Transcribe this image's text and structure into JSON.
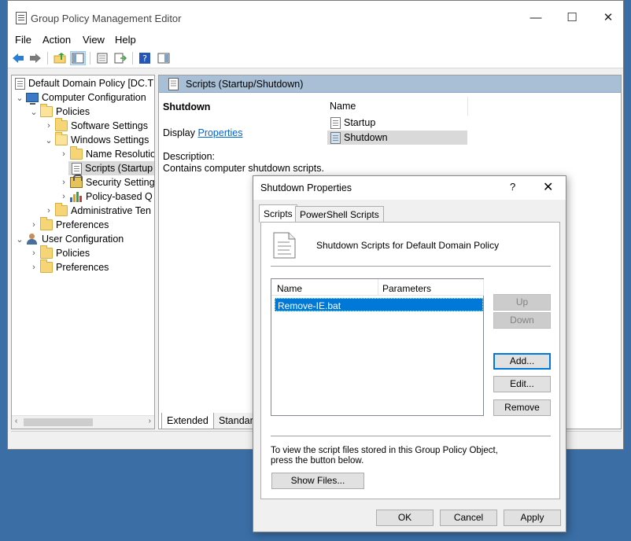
{
  "window": {
    "title": "Group Policy Management Editor",
    "minimize": "—",
    "maximize": "☐",
    "close": "✕"
  },
  "menu": [
    "File",
    "Action",
    "View",
    "Help"
  ],
  "toolbar": {
    "icons": [
      "back-arrow-icon",
      "forward-arrow-icon",
      "up-folder-icon",
      "show-hide-tree-icon",
      "properties-icon",
      "export-list-icon",
      "help-icon",
      "show-action-pane-icon"
    ]
  },
  "tree": {
    "items": [
      {
        "label": "Default Domain Policy [DC.TH",
        "chev": ""
      },
      {
        "label": "Computer Configuration",
        "chev": "⌄"
      },
      {
        "label": "Policies",
        "chev": "⌄"
      },
      {
        "label": "Software Settings",
        "chev": "›"
      },
      {
        "label": "Windows Settings",
        "chev": "⌄"
      },
      {
        "label": "Name Resolutio",
        "chev": "›"
      },
      {
        "label": "Scripts (Startup",
        "chev": ""
      },
      {
        "label": "Security Setting",
        "chev": "›"
      },
      {
        "label": "Policy-based Q",
        "chev": "›"
      },
      {
        "label": "Administrative Ten",
        "chev": "›"
      },
      {
        "label": "Preferences",
        "chev": "›"
      },
      {
        "label": "User Configuration",
        "chev": "⌄"
      },
      {
        "label": "Policies",
        "chev": "›"
      },
      {
        "label": "Preferences",
        "chev": "›"
      }
    ],
    "scroll_left": "‹",
    "scroll_right": "›"
  },
  "details": {
    "header": "Scripts (Startup/Shutdown)",
    "heading": "Shutdown",
    "display_prefix": "Display",
    "display_link": "Properties",
    "description_label": "Description:",
    "description_text": "Contains computer shutdown scripts.",
    "column_name": "Name",
    "items": [
      "Startup",
      "Shutdown"
    ],
    "selected_item": "Shutdown",
    "tabs": [
      "Extended",
      "Standard"
    ]
  },
  "dialog": {
    "title": "Shutdown Properties",
    "help": "?",
    "close": "✕",
    "tabs": [
      "Scripts",
      "PowerShell Scripts"
    ],
    "caption": "Shutdown Scripts for Default Domain Policy",
    "columns": [
      "Name",
      "Parameters"
    ],
    "rows": [
      {
        "name": "Remove-IE.bat",
        "parameters": ""
      }
    ],
    "buttons": {
      "up": "Up",
      "down": "Down",
      "add": "Add...",
      "edit": "Edit...",
      "remove": "Remove",
      "show_files": "Show Files...",
      "ok": "OK",
      "cancel": "Cancel",
      "apply": "Apply"
    },
    "hint": "To view the script files stored in this Group Policy Object, press the button below."
  },
  "colors": {
    "desktop": "#3a6ea5",
    "header_band": "#a9bfd6",
    "selection": "#0078d7",
    "link": "#0066cc"
  }
}
